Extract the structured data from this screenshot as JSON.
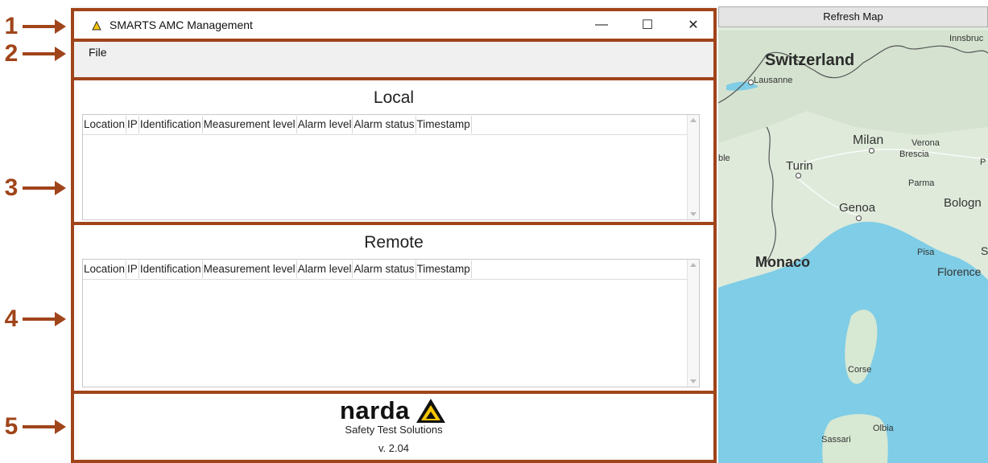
{
  "callouts": [
    "1",
    "2",
    "3",
    "4",
    "5"
  ],
  "window": {
    "title": "SMARTS AMC Management",
    "minimize": "—",
    "maximize": "☐",
    "close": "✕"
  },
  "menu": {
    "file": "File"
  },
  "local": {
    "title": "Local",
    "columns": [
      "Location",
      "IP",
      "Identification",
      "Measurement level",
      "Alarm level",
      "Alarm status",
      "Timestamp"
    ]
  },
  "remote": {
    "title": "Remote",
    "columns": [
      "Location",
      "IP",
      "Identification",
      "Measurement level",
      "Alarm level",
      "Alarm status",
      "Timestamp"
    ]
  },
  "footer": {
    "logo_text": "narda",
    "tagline": "Safety Test Solutions",
    "version": "v. 2.04"
  },
  "map": {
    "refresh_label": "Refresh Map",
    "labels": {
      "switzerland": "Switzerland",
      "lausanne": "Lausanne",
      "innsbruck": "Innsbruc",
      "milan": "Milan",
      "verona": "Verona",
      "brescia": "Brescia",
      "turin": "Turin",
      "parma": "Parma",
      "genoa": "Genoa",
      "bologna": "Bologn",
      "monaco": "Monaco",
      "pisa": "Pisa",
      "florence": "Florence",
      "corse": "Corse",
      "olbia": "Olbia",
      "sassari": "Sassari",
      "ble": "ble",
      "p_edge": "P",
      "s_edge": "S"
    }
  },
  "colors": {
    "annotation": "#a0441a",
    "sea": "#7fcde6",
    "land": "#dde9dc",
    "narda_yellow": "#f5c400"
  }
}
